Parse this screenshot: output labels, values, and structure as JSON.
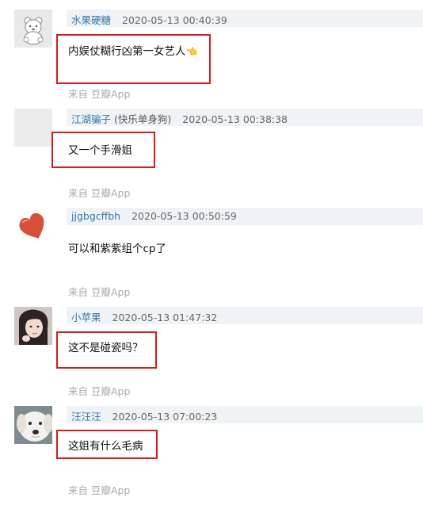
{
  "comments": [
    {
      "user": "水果硬糖",
      "user_note": "",
      "time": "2020-05-13 00:40:39",
      "text": "内娱仗糊行凶第一女艺人",
      "emoji": "👈",
      "source": "来自 豆瓣App",
      "avatar": "bear-avatar"
    },
    {
      "user": "江湖骗子",
      "user_note": " (快乐单身狗)",
      "time": "2020-05-13 00:38:38",
      "text": "又一个手滑姐",
      "emoji": "",
      "source": "来自 豆瓣App",
      "avatar": "blank-avatar"
    },
    {
      "user": "jjgbgcffbh",
      "user_note": "",
      "time": "2020-05-13 00:50:59",
      "text": "可以和紫紫组个cp了",
      "emoji": "",
      "source": "来自 豆瓣App",
      "avatar": "heart-avatar"
    },
    {
      "user": "小苹果",
      "user_note": "",
      "time": "2020-05-13 01:47:32",
      "text": "这不是碰瓷吗？",
      "emoji": "",
      "source": "来自 豆瓣App",
      "avatar": "girl-avatar"
    },
    {
      "user": "汪汪汪",
      "user_note": "",
      "time": "2020-05-13 07:00:23",
      "text": "这姐有什么毛病",
      "emoji": "",
      "source": "来自 豆瓣App",
      "avatar": "dog-avatar"
    }
  ],
  "colors": {
    "username": "#3377aa",
    "highlight": "#d81c1c",
    "meta_bar": "#f0f3f5",
    "source": "#aaaaaa"
  }
}
